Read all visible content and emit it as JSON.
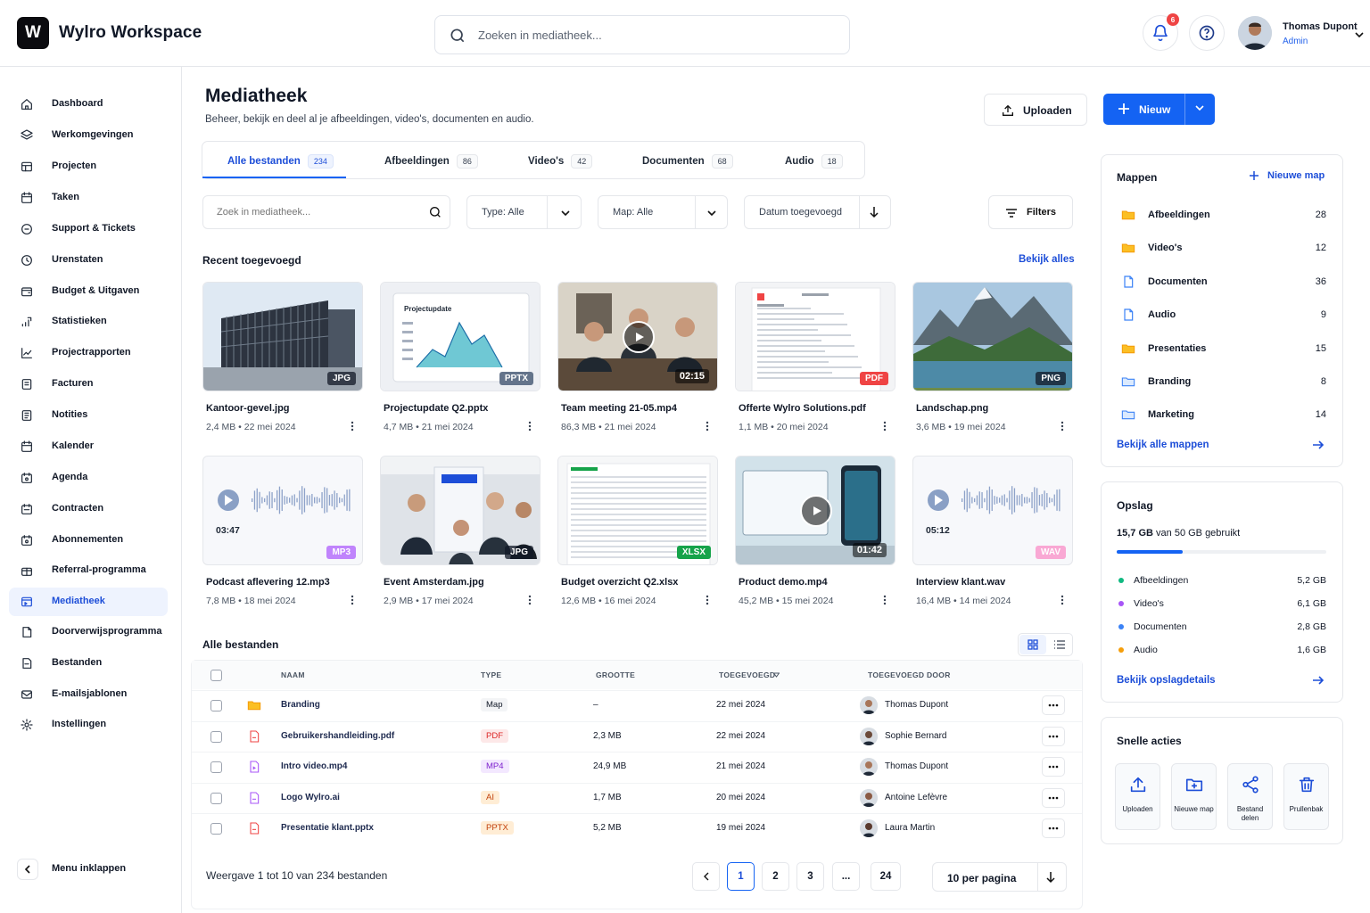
{
  "app": {
    "logo_letter": "W",
    "title": "Wylro Workspace"
  },
  "header": {
    "search_placeholder": "Zoeken in mediatheek...",
    "notification_count": "6",
    "user_name": "Thomas Dupont",
    "user_role": "Admin"
  },
  "sidebar": {
    "items": [
      {
        "label": "Dashboard",
        "icon": "home-icon"
      },
      {
        "label": "Werkomgevingen",
        "icon": "layers-icon"
      },
      {
        "label": "Projecten",
        "icon": "grid-icon"
      },
      {
        "label": "Taken",
        "icon": "calendar-check-icon"
      },
      {
        "label": "Support & Tickets",
        "icon": "chat-icon"
      },
      {
        "label": "Urenstaten",
        "icon": "clock-icon"
      },
      {
        "label": "Budget & Uitgaven",
        "icon": "wallet-icon"
      },
      {
        "label": "Statistieken",
        "icon": "stats-icon"
      },
      {
        "label": "Projectrapporten",
        "icon": "chart-line-icon"
      },
      {
        "label": "Facturen",
        "icon": "invoice-icon"
      },
      {
        "label": "Notities",
        "icon": "note-icon"
      },
      {
        "label": "Kalender",
        "icon": "calendar-icon"
      },
      {
        "label": "Agenda",
        "icon": "agenda-icon"
      },
      {
        "label": "Contracten",
        "icon": "contract-icon"
      },
      {
        "label": "Abonnementen",
        "icon": "subscription-icon"
      },
      {
        "label": "Referral-programma",
        "icon": "gift-icon"
      },
      {
        "label": "Mediatheek",
        "icon": "media-icon",
        "active": true
      },
      {
        "label": "Doorverwijsprogramma",
        "icon": "doc-icon"
      },
      {
        "label": "Bestanden",
        "icon": "files-icon"
      },
      {
        "label": "E-mailsjablonen",
        "icon": "mail-icon"
      },
      {
        "label": "Instellingen",
        "icon": "gear-icon"
      }
    ],
    "collapse_label": "Menu inklappen"
  },
  "page": {
    "title": "Mediatheek",
    "subtitle": "Beheer, bekijk en deel al je afbeeldingen, video's, documenten en audio.",
    "upload_label": "Uploaden",
    "new_label": "Nieuw"
  },
  "tabs": [
    {
      "label": "Alle bestanden",
      "count": "234",
      "active": true
    },
    {
      "label": "Afbeeldingen",
      "count": "86"
    },
    {
      "label": "Video's",
      "count": "42"
    },
    {
      "label": "Documenten",
      "count": "68"
    },
    {
      "label": "Audio",
      "count": "18"
    }
  ],
  "filters": {
    "search_placeholder": "Zoek in mediatheek...",
    "type": "Type: Alle",
    "folder": "Map: Alle",
    "sort": "Datum toegevoegd",
    "filters_label": "Filters"
  },
  "recent": {
    "heading": "Recent toegevoegd",
    "view_all": "Bekijk alles",
    "items": [
      {
        "name": "Kantoor-gevel.jpg",
        "meta": "2,4 MB • 22 mei 2024",
        "ext": "JPG",
        "ext_color": "#1f2937",
        "duration": ""
      },
      {
        "name": "Projectupdate Q2.pptx",
        "meta": "4,7 MB • 21 mei 2024",
        "ext": "PPTX",
        "ext_color": "#64748b",
        "duration": "",
        "thumb_text": "Projectupdate"
      },
      {
        "name": "Team meeting 21-05.mp4",
        "meta": "86,3 MB • 21 mei 2024",
        "ext": "",
        "duration": "02:15"
      },
      {
        "name": "Offerte Wylro Solutions.pdf",
        "meta": "1,1 MB • 20 mei 2024",
        "ext": "PDF",
        "ext_color": "#ef4444",
        "duration": ""
      },
      {
        "name": "Landschap.png",
        "meta": "3,6 MB • 19 mei 2024",
        "ext": "PNG",
        "ext_color": "#1f2937",
        "duration": ""
      },
      {
        "name": "Podcast aflevering 12.mp3",
        "meta": "7,8 MB • 18 mei 2024",
        "ext": "MP3",
        "ext_color": "#c084fc",
        "duration": "03:47"
      },
      {
        "name": "Event Amsterdam.jpg",
        "meta": "2,9 MB • 17 mei 2024",
        "ext": "JPG",
        "ext_color": "#1f2937",
        "duration": ""
      },
      {
        "name": "Budget overzicht Q2.xlsx",
        "meta": "12,6 MB • 16 mei 2024",
        "ext": "XLSX",
        "ext_color": "#16a34a",
        "duration": ""
      },
      {
        "name": "Product demo.mp4",
        "meta": "45,2 MB • 15 mei 2024",
        "ext": "",
        "duration": "01:42"
      },
      {
        "name": "Interview klant.wav",
        "meta": "16,4 MB • 14 mei 2024",
        "ext": "WAV",
        "ext_color": "#f9a8d4",
        "duration": "05:12"
      }
    ]
  },
  "all_files": {
    "heading": "Alle bestanden",
    "columns": [
      "NAAM",
      "TYPE",
      "GROOTTE",
      "TOEGEVOEGD",
      "TOEGEVOEGD DOOR"
    ],
    "rows": [
      {
        "name": "Branding",
        "type": "Map",
        "size": "–",
        "date": "22 mei 2024",
        "by": "Thomas Dupont",
        "icon": "folder-icon"
      },
      {
        "name": "Gebruikershandleiding.pdf",
        "type": "PDF",
        "size": "2,3 MB",
        "date": "22 mei 2024",
        "by": "Sophie Bernard",
        "icon": "pdf-file-icon"
      },
      {
        "name": "Intro video.mp4",
        "type": "MP4",
        "size": "24,9 MB",
        "date": "21 mei 2024",
        "by": "Thomas Dupont",
        "icon": "video-file-icon"
      },
      {
        "name": "Logo Wylro.ai",
        "type": "AI",
        "size": "1,7 MB",
        "date": "20 mei 2024",
        "by": "Antoine Lefèvre",
        "icon": "ai-file-icon"
      },
      {
        "name": "Presentatie klant.pptx",
        "type": "PPTX",
        "size": "5,2 MB",
        "date": "19 mei 2024",
        "by": "Laura Martin",
        "icon": "pptx-file-icon"
      }
    ],
    "showing": "Weergave 1 tot 10 van 234 bestanden",
    "pages": [
      "1",
      "2",
      "3",
      "...",
      "24"
    ],
    "per_page": "10 per pagina"
  },
  "folders": {
    "heading": "Mappen",
    "new_folder": "Nieuwe map",
    "items": [
      {
        "name": "Afbeeldingen",
        "count": "28",
        "color": "#fbbf24"
      },
      {
        "name": "Video's",
        "count": "12",
        "color": "#fbbf24"
      },
      {
        "name": "Documenten",
        "count": "36",
        "color": "#3b82f6"
      },
      {
        "name": "Audio",
        "count": "9",
        "color": "#3b82f6"
      },
      {
        "name": "Presentaties",
        "count": "15",
        "color": "#fbbf24"
      },
      {
        "name": "Branding",
        "count": "8",
        "color": "#3b82f6"
      },
      {
        "name": "Marketing",
        "count": "14",
        "color": "#3b82f6"
      }
    ],
    "view_all": "Bekijk alle mappen"
  },
  "storage": {
    "heading": "Opslag",
    "used": "15,7 GB",
    "used_suffix": "van 50 GB gebruikt",
    "used_fraction": 0.314,
    "items": [
      {
        "name": "Afbeeldingen",
        "value": "5,2 GB",
        "color": "#10b981"
      },
      {
        "name": "Video's",
        "value": "6,1 GB",
        "color": "#a855f7"
      },
      {
        "name": "Documenten",
        "value": "2,8 GB",
        "color": "#3b82f6"
      },
      {
        "name": "Audio",
        "value": "1,6 GB",
        "color": "#f59e0b"
      }
    ],
    "details_link": "Bekijk opslagdetails"
  },
  "quick_actions": {
    "heading": "Snelle acties",
    "items": [
      {
        "label": "Uploaden",
        "icon": "upload-icon"
      },
      {
        "label": "Nieuwe map",
        "icon": "folder-plus-icon"
      },
      {
        "label": "Bestand delen",
        "icon": "share-icon"
      },
      {
        "label": "Prullenbak",
        "icon": "trash-icon"
      }
    ]
  }
}
